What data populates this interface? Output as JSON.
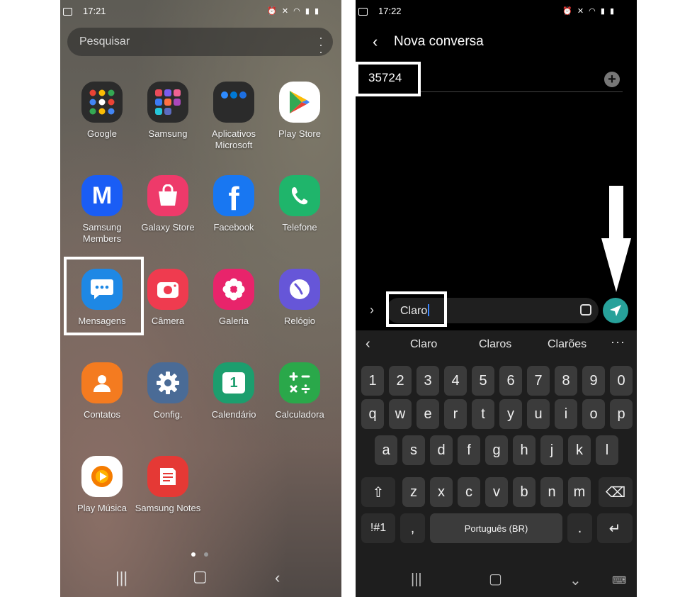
{
  "left": {
    "status": {
      "time": "17:21"
    },
    "search": {
      "placeholder": "Pesquisar"
    },
    "apps": [
      {
        "label": "Google",
        "icon": "google-folder-icon"
      },
      {
        "label": "Samsung",
        "icon": "samsung-folder-icon"
      },
      {
        "label": "Aplicativos Microsoft",
        "icon": "microsoft-folder-icon"
      },
      {
        "label": "Play Store",
        "icon": "play-store-icon"
      },
      {
        "label": "Samsung Members",
        "icon": "samsung-members-icon"
      },
      {
        "label": "Galaxy Store",
        "icon": "galaxy-store-icon"
      },
      {
        "label": "Facebook",
        "icon": "facebook-icon"
      },
      {
        "label": "Telefone",
        "icon": "phone-icon"
      },
      {
        "label": "Mensagens",
        "icon": "messages-icon"
      },
      {
        "label": "Câmera",
        "icon": "camera-icon"
      },
      {
        "label": "Galeria",
        "icon": "gallery-icon"
      },
      {
        "label": "Relógio",
        "icon": "clock-icon"
      },
      {
        "label": "Contatos",
        "icon": "contacts-icon"
      },
      {
        "label": "Config.",
        "icon": "settings-icon"
      },
      {
        "label": "Calendário",
        "icon": "calendar-icon"
      },
      {
        "label": "Calculadora",
        "icon": "calculator-icon"
      },
      {
        "label": "Play Música",
        "icon": "play-music-icon"
      },
      {
        "label": "Samsung Notes",
        "icon": "samsung-notes-icon"
      }
    ],
    "calendar_day": "1",
    "facebook_letter": "f",
    "members_letter": "M",
    "highlight_color": "#ffffff"
  },
  "right": {
    "status": {
      "time": "17:22"
    },
    "header": {
      "title": "Nova conversa"
    },
    "recipient": "35724",
    "compose_text": "Claro",
    "send_color": "#27a19a",
    "suggestions": [
      "Claro",
      "Claros",
      "Clarões"
    ],
    "keys": {
      "row1": [
        "1",
        "2",
        "3",
        "4",
        "5",
        "6",
        "7",
        "8",
        "9",
        "0"
      ],
      "row2": [
        "q",
        "w",
        "e",
        "r",
        "t",
        "y",
        "u",
        "i",
        "o",
        "p"
      ],
      "row3": [
        "a",
        "s",
        "d",
        "f",
        "g",
        "h",
        "j",
        "k",
        "l"
      ],
      "row4": [
        "z",
        "x",
        "c",
        "v",
        "b",
        "n",
        "m"
      ],
      "symbols": "!#1",
      "comma": ",",
      "space": "Português (BR)",
      "period": "."
    }
  }
}
